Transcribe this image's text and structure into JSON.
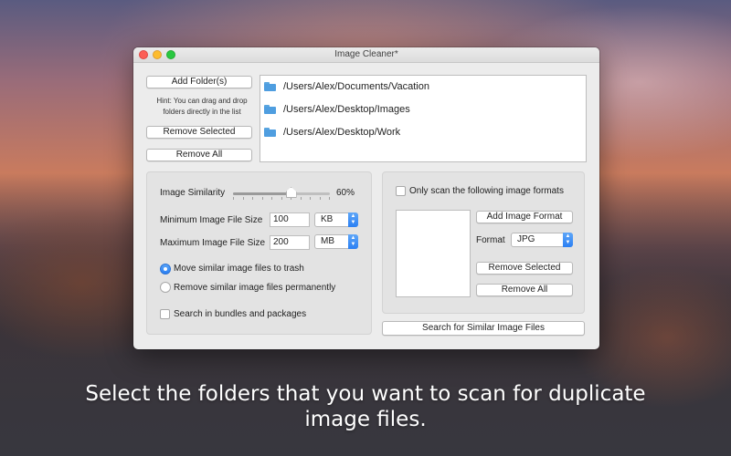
{
  "window": {
    "title": "Image Cleaner*"
  },
  "folders_panel": {
    "add_folder_label": "Add Folder(s)",
    "hint": "Hint: You can drag and drop folders directly in the list",
    "remove_selected_label": "Remove Selected",
    "remove_all_label": "Remove All",
    "folders": [
      "/Users/Alex/Documents/Vacation",
      "/Users/Alex/Desktop/Images",
      "/Users/Alex/Desktop/Work"
    ],
    "folder_icon": "folder-icon"
  },
  "options": {
    "similarity_label": "Image Similarity",
    "similarity_value": "60%",
    "similarity_fraction": 0.6,
    "min_size_label": "Minimum Image File Size",
    "min_size_value": "100",
    "min_size_unit": "KB",
    "max_size_label": "Maximum Image File Size",
    "max_size_value": "200",
    "max_size_unit": "MB",
    "radio_trash": "Move similar image files to trash",
    "radio_permanent": "Remove similar image files permanently",
    "radio_selected": "trash",
    "bundles_label": "Search in bundles and packages",
    "bundles_checked": false
  },
  "formats": {
    "only_scan_label": "Only scan the following image formats",
    "only_scan_checked": false,
    "add_format_label": "Add Image Format",
    "format_label": "Format",
    "format_value": "JPG",
    "remove_selected_label": "Remove Selected",
    "remove_all_label": "Remove All",
    "search_label": "Search for Similar Image Files"
  },
  "caption": {
    "line1": "Select the folders that you want to scan for duplicate",
    "line2": "image files."
  },
  "colors": {
    "accent": "#2a7ff3",
    "folder": "#4f9ee0",
    "close": "#fc5f57",
    "minimize": "#fdbc2e",
    "maximize": "#28c840"
  }
}
